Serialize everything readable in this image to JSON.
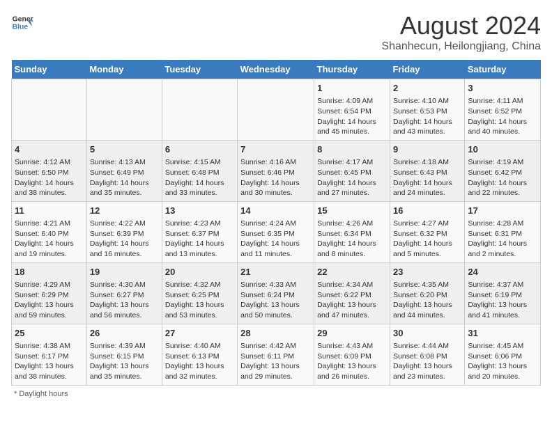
{
  "header": {
    "logo_general": "General",
    "logo_blue": "Blue",
    "month_year": "August 2024",
    "location": "Shanhecun, Heilongjiang, China"
  },
  "weekdays": [
    "Sunday",
    "Monday",
    "Tuesday",
    "Wednesday",
    "Thursday",
    "Friday",
    "Saturday"
  ],
  "weeks": [
    [
      {
        "day": "",
        "info": ""
      },
      {
        "day": "",
        "info": ""
      },
      {
        "day": "",
        "info": ""
      },
      {
        "day": "",
        "info": ""
      },
      {
        "day": "1",
        "info": "Sunrise: 4:09 AM\nSunset: 6:54 PM\nDaylight: 14 hours and 45 minutes."
      },
      {
        "day": "2",
        "info": "Sunrise: 4:10 AM\nSunset: 6:53 PM\nDaylight: 14 hours and 43 minutes."
      },
      {
        "day": "3",
        "info": "Sunrise: 4:11 AM\nSunset: 6:52 PM\nDaylight: 14 hours and 40 minutes."
      }
    ],
    [
      {
        "day": "4",
        "info": "Sunrise: 4:12 AM\nSunset: 6:50 PM\nDaylight: 14 hours and 38 minutes."
      },
      {
        "day": "5",
        "info": "Sunrise: 4:13 AM\nSunset: 6:49 PM\nDaylight: 14 hours and 35 minutes."
      },
      {
        "day": "6",
        "info": "Sunrise: 4:15 AM\nSunset: 6:48 PM\nDaylight: 14 hours and 33 minutes."
      },
      {
        "day": "7",
        "info": "Sunrise: 4:16 AM\nSunset: 6:46 PM\nDaylight: 14 hours and 30 minutes."
      },
      {
        "day": "8",
        "info": "Sunrise: 4:17 AM\nSunset: 6:45 PM\nDaylight: 14 hours and 27 minutes."
      },
      {
        "day": "9",
        "info": "Sunrise: 4:18 AM\nSunset: 6:43 PM\nDaylight: 14 hours and 24 minutes."
      },
      {
        "day": "10",
        "info": "Sunrise: 4:19 AM\nSunset: 6:42 PM\nDaylight: 14 hours and 22 minutes."
      }
    ],
    [
      {
        "day": "11",
        "info": "Sunrise: 4:21 AM\nSunset: 6:40 PM\nDaylight: 14 hours and 19 minutes."
      },
      {
        "day": "12",
        "info": "Sunrise: 4:22 AM\nSunset: 6:39 PM\nDaylight: 14 hours and 16 minutes."
      },
      {
        "day": "13",
        "info": "Sunrise: 4:23 AM\nSunset: 6:37 PM\nDaylight: 14 hours and 13 minutes."
      },
      {
        "day": "14",
        "info": "Sunrise: 4:24 AM\nSunset: 6:35 PM\nDaylight: 14 hours and 11 minutes."
      },
      {
        "day": "15",
        "info": "Sunrise: 4:26 AM\nSunset: 6:34 PM\nDaylight: 14 hours and 8 minutes."
      },
      {
        "day": "16",
        "info": "Sunrise: 4:27 AM\nSunset: 6:32 PM\nDaylight: 14 hours and 5 minutes."
      },
      {
        "day": "17",
        "info": "Sunrise: 4:28 AM\nSunset: 6:31 PM\nDaylight: 14 hours and 2 minutes."
      }
    ],
    [
      {
        "day": "18",
        "info": "Sunrise: 4:29 AM\nSunset: 6:29 PM\nDaylight: 13 hours and 59 minutes."
      },
      {
        "day": "19",
        "info": "Sunrise: 4:30 AM\nSunset: 6:27 PM\nDaylight: 13 hours and 56 minutes."
      },
      {
        "day": "20",
        "info": "Sunrise: 4:32 AM\nSunset: 6:25 PM\nDaylight: 13 hours and 53 minutes."
      },
      {
        "day": "21",
        "info": "Sunrise: 4:33 AM\nSunset: 6:24 PM\nDaylight: 13 hours and 50 minutes."
      },
      {
        "day": "22",
        "info": "Sunrise: 4:34 AM\nSunset: 6:22 PM\nDaylight: 13 hours and 47 minutes."
      },
      {
        "day": "23",
        "info": "Sunrise: 4:35 AM\nSunset: 6:20 PM\nDaylight: 13 hours and 44 minutes."
      },
      {
        "day": "24",
        "info": "Sunrise: 4:37 AM\nSunset: 6:19 PM\nDaylight: 13 hours and 41 minutes."
      }
    ],
    [
      {
        "day": "25",
        "info": "Sunrise: 4:38 AM\nSunset: 6:17 PM\nDaylight: 13 hours and 38 minutes."
      },
      {
        "day": "26",
        "info": "Sunrise: 4:39 AM\nSunset: 6:15 PM\nDaylight: 13 hours and 35 minutes."
      },
      {
        "day": "27",
        "info": "Sunrise: 4:40 AM\nSunset: 6:13 PM\nDaylight: 13 hours and 32 minutes."
      },
      {
        "day": "28",
        "info": "Sunrise: 4:42 AM\nSunset: 6:11 PM\nDaylight: 13 hours and 29 minutes."
      },
      {
        "day": "29",
        "info": "Sunrise: 4:43 AM\nSunset: 6:09 PM\nDaylight: 13 hours and 26 minutes."
      },
      {
        "day": "30",
        "info": "Sunrise: 4:44 AM\nSunset: 6:08 PM\nDaylight: 13 hours and 23 minutes."
      },
      {
        "day": "31",
        "info": "Sunrise: 4:45 AM\nSunset: 6:06 PM\nDaylight: 13 hours and 20 minutes."
      }
    ]
  ],
  "footer": "Daylight hours"
}
